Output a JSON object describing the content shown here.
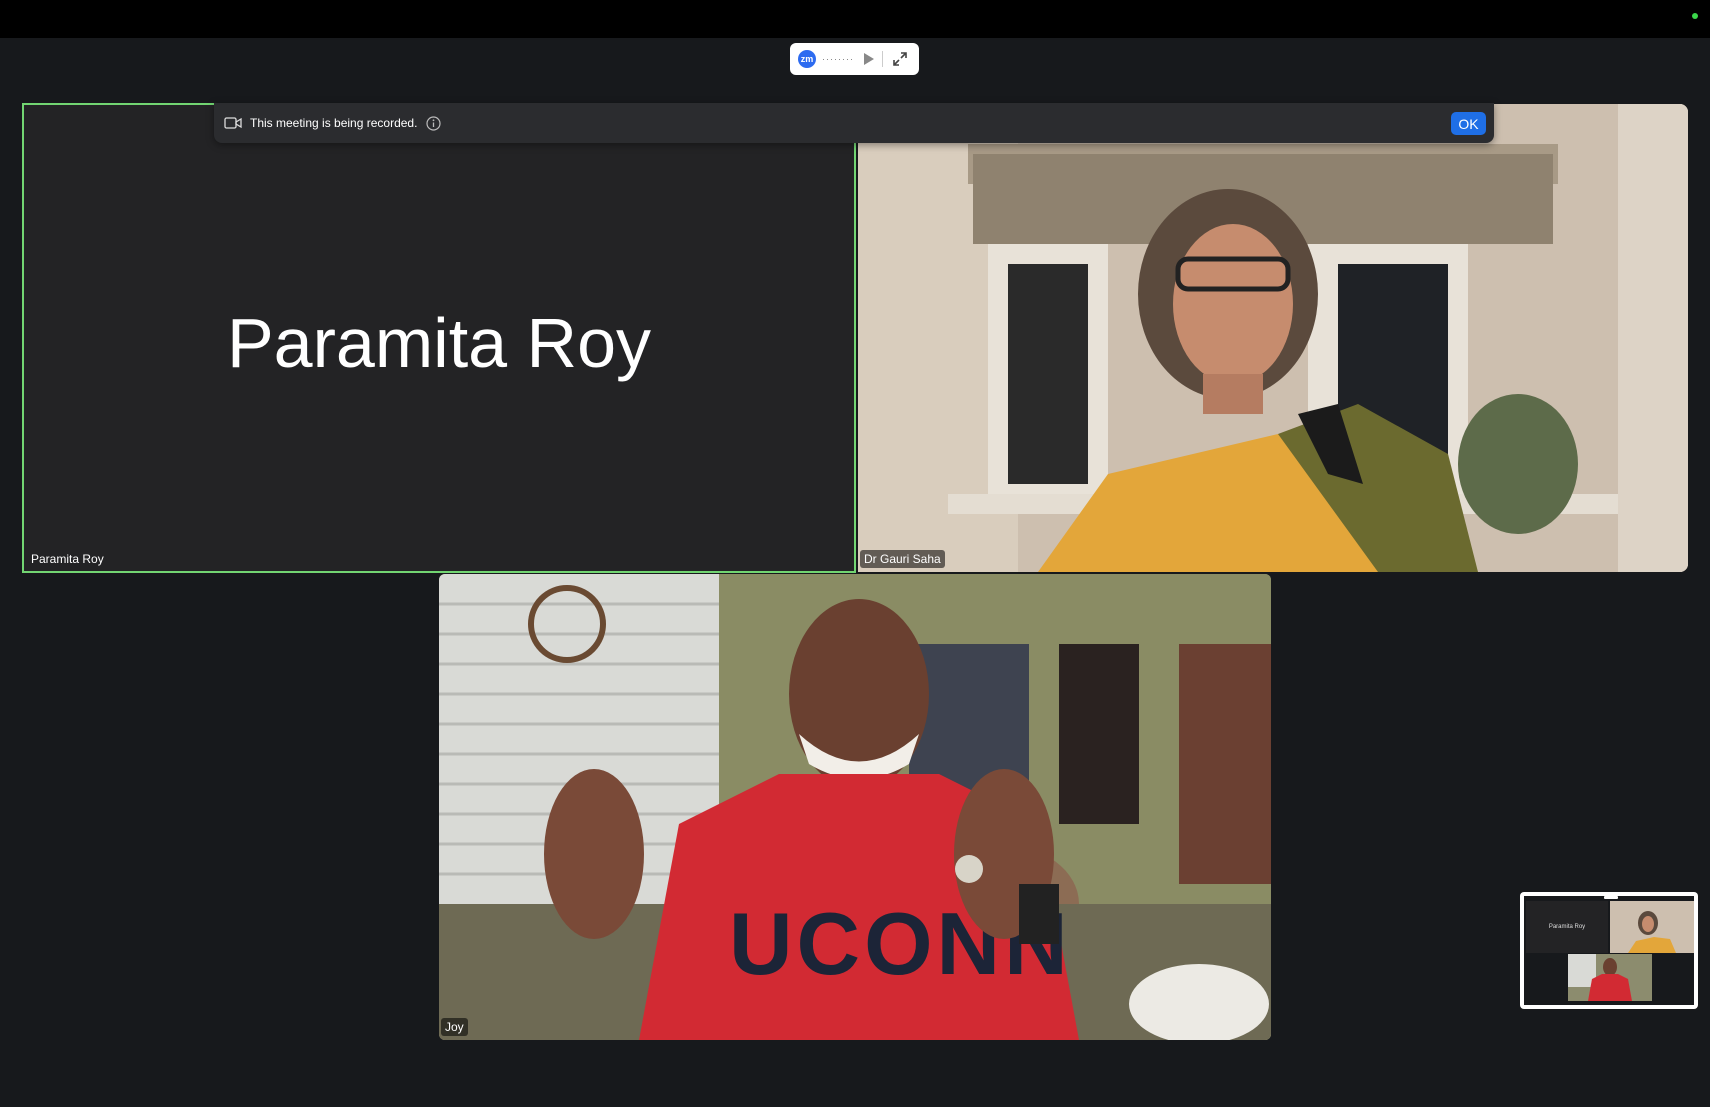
{
  "toolbar": {
    "logo_text": "zm"
  },
  "recording_banner": {
    "message": "This meeting is being recorded.",
    "ok_label": "OK"
  },
  "participants": [
    {
      "name": "Paramita Roy",
      "video_on": false,
      "active_speaker": true
    },
    {
      "name": "Dr Gauri Saha",
      "video_on": true
    },
    {
      "name": "Joy",
      "video_on": true
    }
  ],
  "thumbnail": {
    "paramita_label": "Paramita Roy"
  },
  "colors": {
    "active_speaker_border": "#72d572",
    "ok_button": "#1f6fe6",
    "background": "#17191c"
  }
}
